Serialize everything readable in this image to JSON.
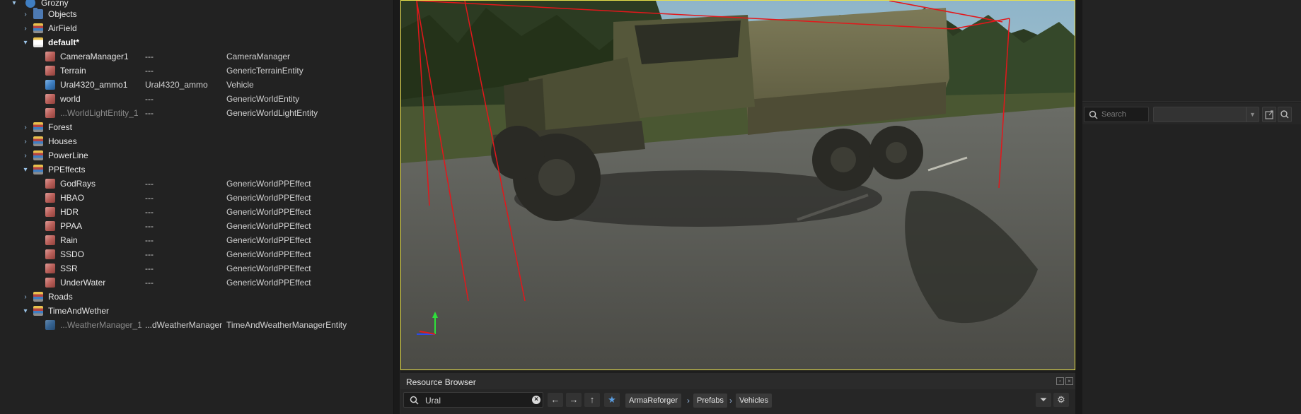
{
  "hierarchy": {
    "rows": [
      {
        "name": "Grozny",
        "col2": "",
        "col3": ""
      },
      {
        "name": "Objects",
        "col2": "",
        "col3": ""
      },
      {
        "name": "AirField",
        "col2": "",
        "col3": ""
      },
      {
        "name": "default*",
        "col2": "",
        "col3": ""
      },
      {
        "name": "CameraManager1",
        "col2": "---",
        "col3": "CameraManager"
      },
      {
        "name": "Terrain",
        "col2": "---",
        "col3": "GenericTerrainEntity"
      },
      {
        "name": "Ural4320_ammo1",
        "col2": "Ural4320_ammo",
        "col3": "Vehicle"
      },
      {
        "name": "world",
        "col2": "---",
        "col3": "GenericWorldEntity"
      },
      {
        "name": "...WorldLightEntity_1",
        "col2": "---",
        "col3": "GenericWorldLightEntity"
      },
      {
        "name": "Forest",
        "col2": "",
        "col3": ""
      },
      {
        "name": "Houses",
        "col2": "",
        "col3": ""
      },
      {
        "name": "PowerLine",
        "col2": "",
        "col3": ""
      },
      {
        "name": "PPEffects",
        "col2": "",
        "col3": ""
      },
      {
        "name": "GodRays",
        "col2": "---",
        "col3": "GenericWorldPPEffect"
      },
      {
        "name": "HBAO",
        "col2": "---",
        "col3": "GenericWorldPPEffect"
      },
      {
        "name": "HDR",
        "col2": "---",
        "col3": "GenericWorldPPEffect"
      },
      {
        "name": "PPAA",
        "col2": "---",
        "col3": "GenericWorldPPEffect"
      },
      {
        "name": "Rain",
        "col2": "---",
        "col3": "GenericWorldPPEffect"
      },
      {
        "name": "SSDO",
        "col2": "---",
        "col3": "GenericWorldPPEffect"
      },
      {
        "name": "SSR",
        "col2": "---",
        "col3": "GenericWorldPPEffect"
      },
      {
        "name": "UnderWater",
        "col2": "---",
        "col3": "GenericWorldPPEffect"
      },
      {
        "name": "Roads",
        "col2": "",
        "col3": ""
      },
      {
        "name": "TimeAndWether",
        "col2": "",
        "col3": ""
      },
      {
        "name": "...WeatherManager_1",
        "col2": "...dWeatherManager",
        "col3": "TimeAndWeatherManagerEntity"
      }
    ]
  },
  "resource_browser": {
    "title": "Resource Browser",
    "search_value": "Ural",
    "breadcrumbs": [
      "ArmaReforger",
      "Prefabs",
      "Vehicles"
    ]
  },
  "right_panel": {
    "search_placeholder": "Search",
    "filter_value": ""
  },
  "colors": {
    "viewport_border": "#e8e04a",
    "accent_blue": "#4d7ab3"
  }
}
